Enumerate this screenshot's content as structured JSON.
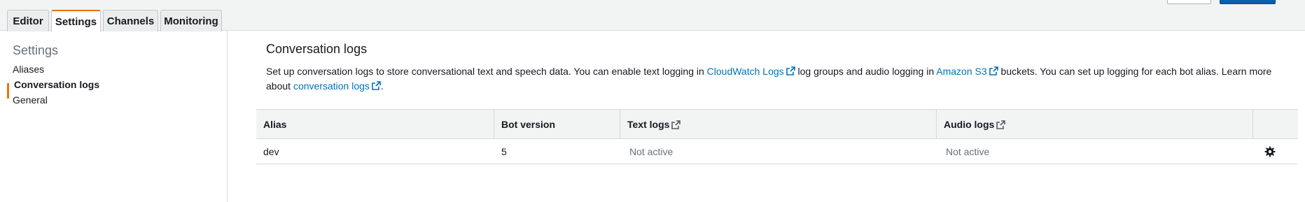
{
  "tabs": [
    {
      "label": "Editor",
      "active": false
    },
    {
      "label": "Settings",
      "active": true
    },
    {
      "label": "Channels",
      "active": false
    },
    {
      "label": "Monitoring",
      "active": false
    }
  ],
  "sidebar": {
    "title": "Settings",
    "items": [
      {
        "label": "Aliases",
        "active": false
      },
      {
        "label": "Conversation logs",
        "active": true
      },
      {
        "label": "General",
        "active": false
      }
    ]
  },
  "main": {
    "title": "Conversation logs",
    "desc": {
      "part1": "Set up conversation logs to store conversational text and speech data. You can enable text logging in",
      "link1": "CloudWatch Logs",
      "part2": "log groups and audio logging in",
      "link2": "Amazon S3",
      "part3": "buckets. You can set up logging for each bot alias. Learn more about",
      "link3": "conversation logs",
      "part4": "."
    }
  },
  "table": {
    "columns": [
      "Alias",
      "Bot version",
      "Text logs",
      "Audio logs"
    ],
    "rows": [
      {
        "alias": "dev",
        "bot_version": "5",
        "text_logs": "Not active",
        "audio_logs": "Not active"
      }
    ]
  },
  "colors": {
    "accent": "#ec7211",
    "link": "#0073bb",
    "primary_button": "#0a5fad"
  },
  "icons": [
    "external-link-icon",
    "gear-icon"
  ]
}
